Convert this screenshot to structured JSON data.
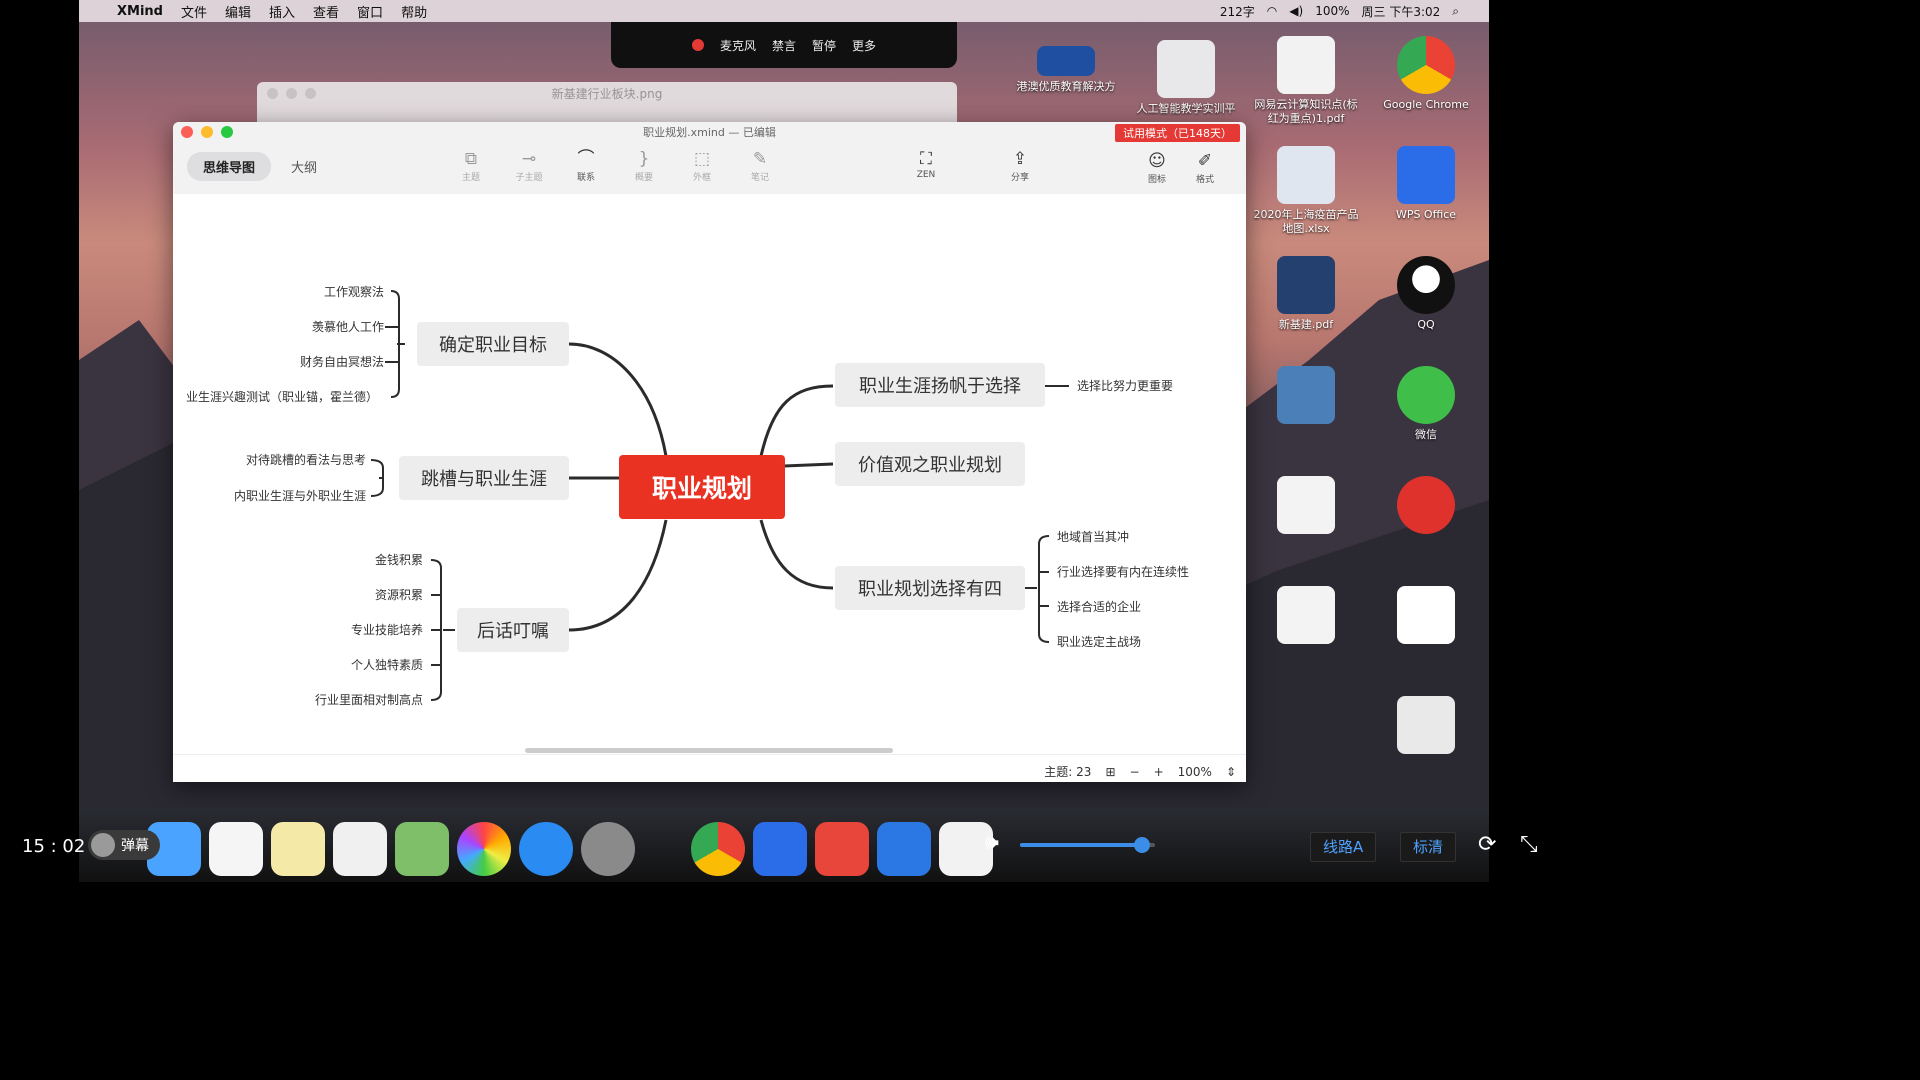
{
  "menubar": {
    "app": "XMind",
    "menus": [
      "文件",
      "编辑",
      "插入",
      "查看",
      "窗口",
      "帮助"
    ],
    "right": [
      "212字",
      "100%",
      "周三 下午3:02"
    ]
  },
  "recorder": {
    "mic": "麦克风",
    "mute": "禁言",
    "pause": "暂停",
    "more": "更多"
  },
  "back_window": {
    "title": "新基建行业板块.png"
  },
  "window": {
    "title": "职业规划.xmind — 已编辑",
    "trial": "试用模式（已148天）",
    "view_tabs": [
      "思维导图",
      "大纲"
    ],
    "tools": {
      "topic": "主题",
      "subtopic": "子主题",
      "relation": "联系",
      "summary": "概要",
      "boundary": "外框",
      "note": "笔记",
      "zen": "ZEN",
      "share": "分享",
      "icon": "图标",
      "format": "格式"
    },
    "status": {
      "topics": "主题: 23",
      "zoom": "100%"
    }
  },
  "mindmap": {
    "central": "职业规划",
    "nodes": {
      "goal": "确定职业目标",
      "jump": "跳槽与职业生涯",
      "advice": "后话叮嘱",
      "choice": "职业生涯扬帆于选择",
      "values": "价值观之职业规划",
      "four": "职业规划选择有四"
    },
    "goal_leaves": [
      "工作观察法",
      "羡慕他人工作",
      "财务自由冥想法",
      "业生涯兴趣测试（职业锚，霍兰德）"
    ],
    "jump_leaves": [
      "对待跳槽的看法与思考",
      "内职业生涯与外职业生涯"
    ],
    "advice_leaves": [
      "金钱积累",
      "资源积累",
      "专业技能培养",
      "个人独特素质",
      "行业里面相对制高点"
    ],
    "choice_leaf": "选择比努力更重要",
    "four_leaves": [
      "地域首当其冲",
      "行业选择要有内在连续性",
      "选择合适的企业",
      "职业选定主战场"
    ]
  },
  "desktop_icons": [
    "Google Chrome",
    "WPS Office",
    "QQ",
    "微信",
    "2020年上海疫苗产品地图.xlsx",
    "新基建.pdf",
    "网易云计算知识点(标红为重点)1.pdf",
    "人工智能教学实训平",
    "港澳优质教育解决方"
  ],
  "player": {
    "time": "15 : 02",
    "danmu": "弹幕",
    "line": "线路A",
    "quality": "标清",
    "volume": 0.9
  }
}
